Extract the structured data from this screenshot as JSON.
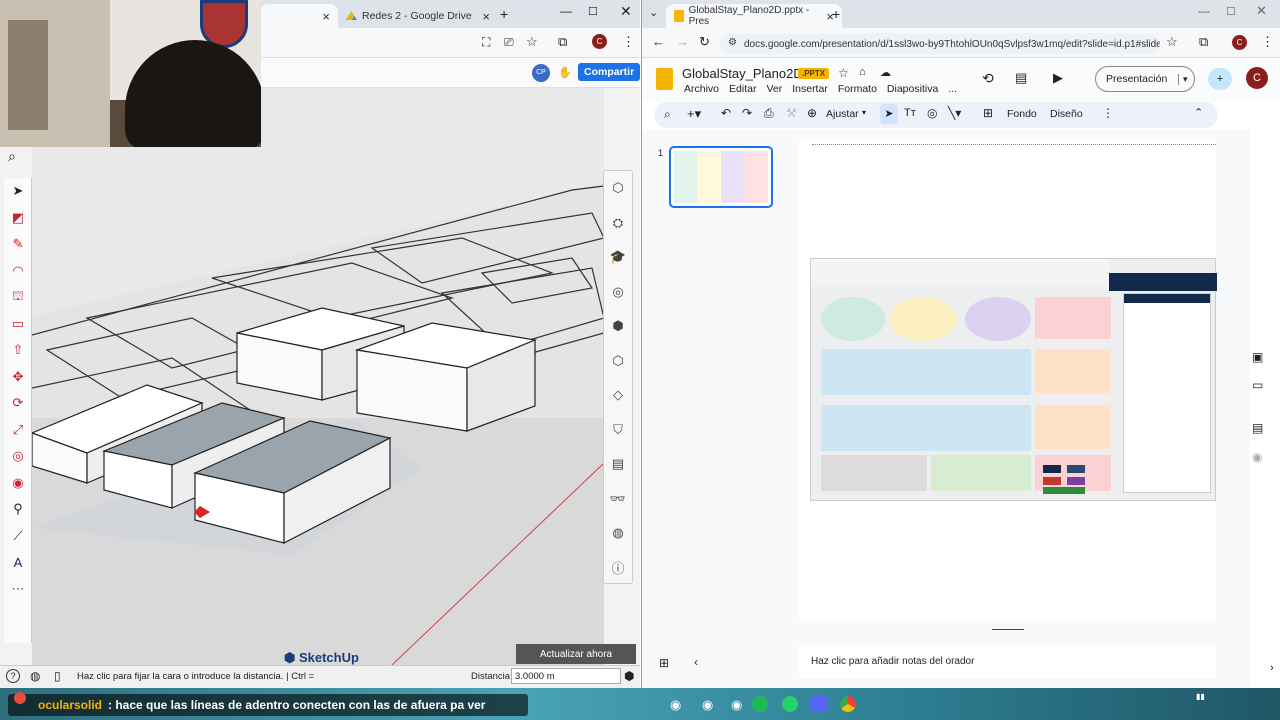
{
  "left_browser": {
    "tab_active_close": "×",
    "tab2_label": "Redes 2 - Google Drive",
    "new_tab": "+",
    "share_label": "Compartir",
    "avatar_initials": "CP"
  },
  "sketchup": {
    "brand": "SketchUp",
    "status_hint": "Haz clic para fijar la cara o introduce la distancia. | Ctrl =",
    "distance_label": "Distancia",
    "distance_value": "3.0000 m",
    "update_button": "Actualizar ahora"
  },
  "right_browser": {
    "tab_label": "GlobalStay_Plano2D.pptx - Pres",
    "url": "docs.google.com/presentation/d/1ssl3wo-by9ThtohlOUn0qSvlpsf3w1mq/edit?slide=id.p1#slide=i...",
    "profile_initial": "C"
  },
  "slides": {
    "doc_title": "GlobalStay_Plano2D",
    "file_badge": ".PPTX",
    "menu": [
      "Archivo",
      "Editar",
      "Ver",
      "Insertar",
      "Formato",
      "Diapositiva",
      "..."
    ],
    "present_label": "Presentación",
    "toolbar_zoom": "Ajustar",
    "toolbar_background": "Fondo",
    "toolbar_design": "Diseño",
    "slide_number": "1",
    "speaker_notes": "Haz clic para añadir notas del orador"
  },
  "taskbar": {
    "chat_user": "ocularsolid",
    "chat_message": ": hace que las líneas de adentro conecten con las de afuera pa ver"
  },
  "colors": {
    "accent": "#1a73e8",
    "slides_yellow": "#f4b400",
    "sketch_red": "#c23b22"
  }
}
